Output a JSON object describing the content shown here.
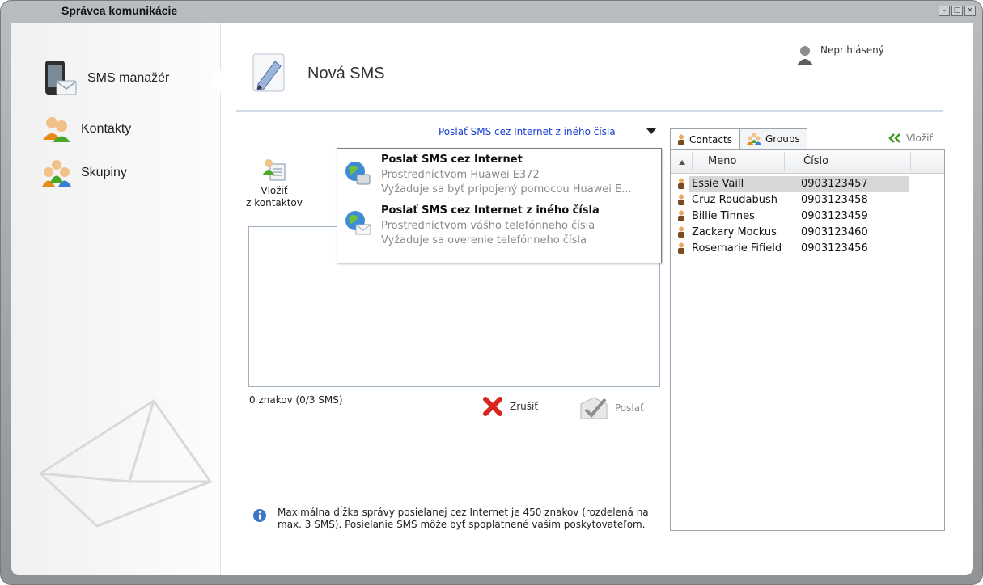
{
  "window": {
    "title": "Správca komunikácie"
  },
  "sidebar": {
    "items": [
      {
        "label": "SMS manažér",
        "icon": "phone-icon"
      },
      {
        "label": "Kontakty",
        "icon": "contacts-icon"
      },
      {
        "label": "Skupiny",
        "icon": "groups-icon"
      }
    ]
  },
  "header": {
    "title": "Nová SMS",
    "user_status": "Neprihlásený"
  },
  "compose": {
    "send_via_label": "Poslať SMS cez Internet z iného čísla",
    "insert_contacts": [
      "Vložiť",
      "z kontaktov"
    ],
    "message_value": "",
    "char_count": "0 znakov (0/3 SMS)",
    "cancel_label": "Zrušiť",
    "send_label": "Poslať",
    "info": "Maximálna dĺžka správy posielanej cez Internet je 450 znakov (rozdelená na max. 3 SMS). Posielanie SMS môže byť spoplatnené vašim poskytovateľom."
  },
  "dropdown": {
    "options": [
      {
        "title": "Poslať SMS cez Internet",
        "line1": "Prostredníctvom Huawei E372",
        "line2": "Vyžaduje sa byť pripojený pomocou Huawei E..."
      },
      {
        "title": "Poslať SMS cez Internet z iného čísla",
        "line1": "Prostredníctvom vášho telefónneho čísla",
        "line2": "Vyžaduje sa overenie telefónneho čísla"
      }
    ]
  },
  "contacts_panel": {
    "tabs": [
      {
        "label": "Contacts",
        "active": true
      },
      {
        "label": "Groups",
        "active": false
      }
    ],
    "insert_label": "Vložiť",
    "columns": [
      "Meno",
      "Číslo"
    ],
    "rows": [
      {
        "name": "Essie Vaill",
        "number": "0903123457",
        "selected": true
      },
      {
        "name": "Cruz Roudabush",
        "number": "0903123458",
        "selected": false
      },
      {
        "name": "Billie Tinnes",
        "number": "0903123459",
        "selected": false
      },
      {
        "name": "Zackary Mockus",
        "number": "0903123460",
        "selected": false
      },
      {
        "name": "Rosemarie Fifield",
        "number": "0903123456",
        "selected": false
      }
    ]
  },
  "colors": {
    "link_blue": "#1a3fcf",
    "cancel_red": "#d9231d",
    "send_gray": "#8a8a8a",
    "insert_green": "#3a9a1e"
  }
}
